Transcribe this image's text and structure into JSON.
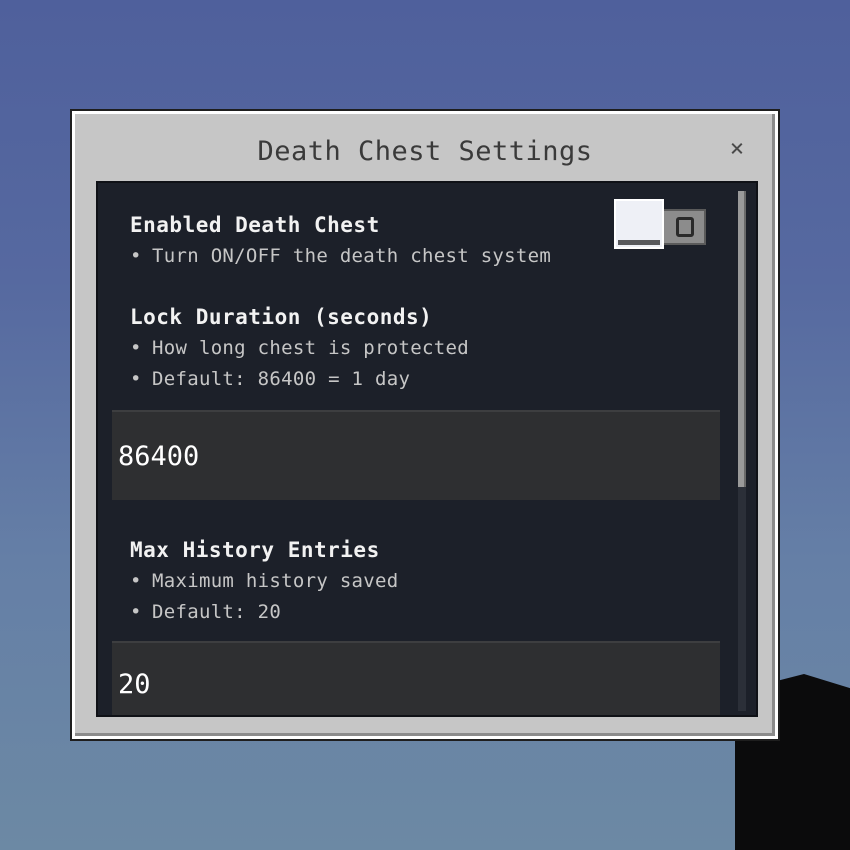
{
  "window": {
    "title": "Death Chest Settings",
    "close_symbol": "×"
  },
  "settings": [
    {
      "heading": "Enabled Death Chest",
      "bullets": [
        "Turn ON/OFF the death chest system"
      ],
      "control": "toggle",
      "toggle_on": false
    },
    {
      "heading": "Lock Duration (seconds)",
      "bullets": [
        "How long chest is protected",
        "Default: 86400 = 1 day"
      ],
      "control": "textbox",
      "value": "86400"
    },
    {
      "heading": "Max History Entries",
      "bullets": [
        "Maximum history saved",
        "Default: 20"
      ],
      "control": "textbox",
      "value": "20"
    }
  ],
  "bullet_symbol": "•",
  "scroll": {
    "thumb_fraction": 0.57,
    "position": 0.0
  },
  "colors": {
    "panel": "#1c2029",
    "frame": "#c6c6c6",
    "textbox": "#2e2f31"
  }
}
